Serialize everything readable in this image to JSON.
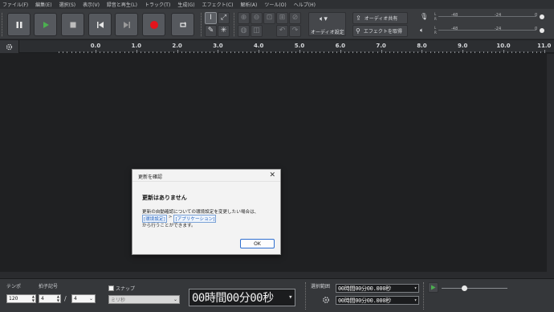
{
  "menu": [
    "ファイル(F)",
    "編集(E)",
    "選択(S)",
    "表示(V)",
    "録音と再生(L)",
    "トラック(T)",
    "生成(G)",
    "エフェクト(C)",
    "解析(A)",
    "ツール(O)",
    "ヘルプ(H)"
  ],
  "toolbar": {
    "audio_setup_label": "オーディオ設定",
    "share_audio_label": "オーディオ共有",
    "get_effects_label": "エフェクトを取得",
    "record_meter": {
      "marks": [
        "-48",
        "-24",
        "0"
      ],
      "channels": [
        "L",
        "R"
      ]
    },
    "play_meter": {
      "marks": [
        "-48",
        "-24",
        "0"
      ],
      "channels": [
        "L",
        "R"
      ]
    },
    "colors": {
      "record": "#e2141c",
      "play": "#4caf50"
    }
  },
  "ruler": {
    "ticks": [
      "0.0",
      "1.0",
      "2.0",
      "3.0",
      "4.0",
      "5.0",
      "6.0",
      "7.0",
      "8.0",
      "9.0",
      "10.0",
      "11.0"
    ]
  },
  "dialog": {
    "title": "更新を確認",
    "close": "✕",
    "heading": "更新はありません",
    "message": "更新の自動確認についての環境設定を変更したい場合は、",
    "link1": "[環境設定]",
    "separator": ">",
    "link2": "[アプリケーション]",
    "tail": "から行うことができます。",
    "ok_label": "OK"
  },
  "bottom": {
    "tempo_label": "テンポ",
    "tempo_value": "120",
    "time_sig_label": "拍子記号",
    "time_sig_num": "4",
    "time_sig_slash": "/",
    "time_sig_den": "4",
    "snap_label": "スナップ",
    "snap_unit": "ミリ秒",
    "time_display": "00時間00分00秒",
    "selection_label": "選択範囲",
    "sel_start": "00時間00分00.000秒",
    "sel_end": "00時間00分00.000秒"
  }
}
